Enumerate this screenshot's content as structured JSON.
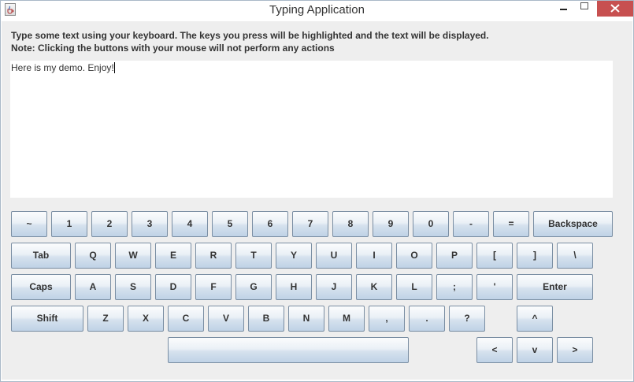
{
  "window": {
    "title": "Typing Application",
    "icon": "java-cup-icon"
  },
  "instructions": {
    "line1": "Type some text using your keyboard. The keys you press will be highlighted and the text will be displayed.",
    "line2": "Note: Clicking the buttons with your mouse will not perform any actions"
  },
  "text_area": {
    "value": "Here is my demo. Enjoy!"
  },
  "keyboard": {
    "row1": [
      "~",
      "1",
      "2",
      "3",
      "4",
      "5",
      "6",
      "7",
      "8",
      "9",
      "0",
      "-",
      "=",
      "Backspace"
    ],
    "row2": [
      "Tab",
      "Q",
      "W",
      "E",
      "R",
      "T",
      "Y",
      "U",
      "I",
      "O",
      "P",
      "[",
      "]",
      "\\"
    ],
    "row3": [
      "Caps",
      "A",
      "S",
      "D",
      "F",
      "G",
      "H",
      "J",
      "K",
      "L",
      ";",
      "'",
      "Enter"
    ],
    "row4": [
      "Shift",
      "Z",
      "X",
      "C",
      "V",
      "B",
      "N",
      "M",
      ",",
      ".",
      "?",
      "^"
    ],
    "row5": [
      "",
      "<",
      "v",
      ">"
    ]
  },
  "colors": {
    "close_button": "#c75050",
    "background": "#eeeeee",
    "key_border": "#7a8ea3"
  }
}
